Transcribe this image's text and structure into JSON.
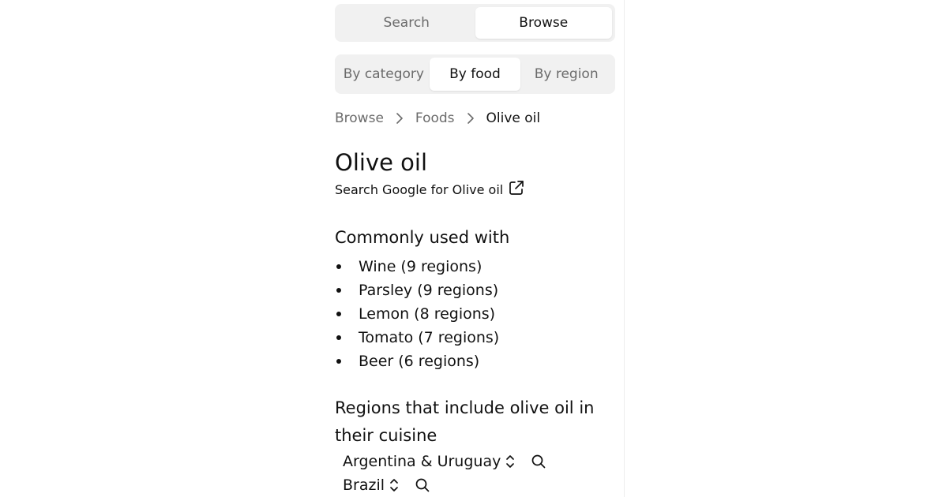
{
  "mode_tabs": [
    {
      "label": "Search",
      "active": false
    },
    {
      "label": "Browse",
      "active": true
    }
  ],
  "browse_tabs": [
    {
      "label": "By category",
      "active": false
    },
    {
      "label": "By food",
      "active": true
    },
    {
      "label": "By region",
      "active": false
    }
  ],
  "breadcrumb": [
    "Browse",
    "Foods",
    "Olive oil"
  ],
  "page_title": "Olive oil",
  "google_link": "Search Google for Olive oil",
  "commonly_used": {
    "heading": "Commonly used with",
    "items": [
      "Wine (9 regions)",
      "Parsley (9 regions)",
      "Lemon (8 regions)",
      "Tomato (7 regions)",
      "Beer (6 regions)"
    ]
  },
  "regions": {
    "heading": "Regions that include olive oil in their cuisine",
    "items": [
      "Argentina & Uruguay",
      "Brazil"
    ]
  },
  "icons": {
    "breadcrumb_separator": "chevron-right-icon",
    "external_link": "external-link-icon",
    "expand": "chevron-up-down-icon",
    "search": "search-icon"
  },
  "colors": {
    "tab_bg": "#f1f1f1",
    "active_tab_bg": "#ffffff",
    "muted_text": "#6b6b6b",
    "text": "#111111"
  }
}
